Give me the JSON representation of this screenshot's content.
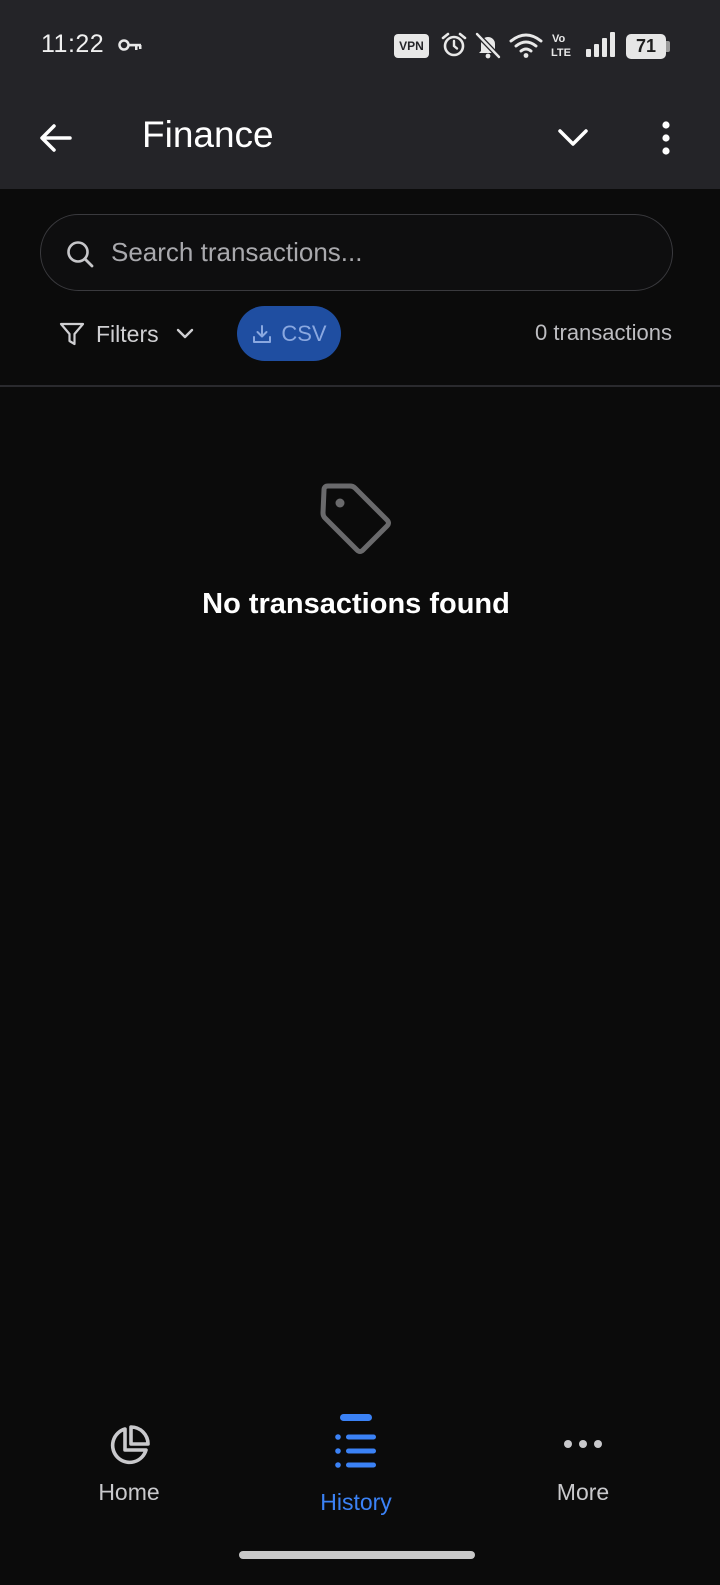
{
  "status_bar": {
    "time": "11:22",
    "vpn": "VPN",
    "battery": "71"
  },
  "app_bar": {
    "title": "Finance"
  },
  "search": {
    "placeholder": "Search transactions..."
  },
  "toolbar": {
    "filters_label": "Filters",
    "csv_label": "CSV",
    "transaction_count": "0 transactions"
  },
  "empty_state": {
    "message": "No transactions found"
  },
  "bottom_nav": {
    "items": [
      {
        "label": "Home",
        "icon": "pie-chart-icon",
        "active": false
      },
      {
        "label": "History",
        "icon": "list-icon",
        "active": true
      },
      {
        "label": "More",
        "icon": "more-horizontal-icon",
        "active": false
      }
    ]
  },
  "colors": {
    "accent": "#3b82f6",
    "csv_button_bg": "#1f4ea1",
    "app_bar_bg": "#242428",
    "background": "#0b0b0b"
  }
}
